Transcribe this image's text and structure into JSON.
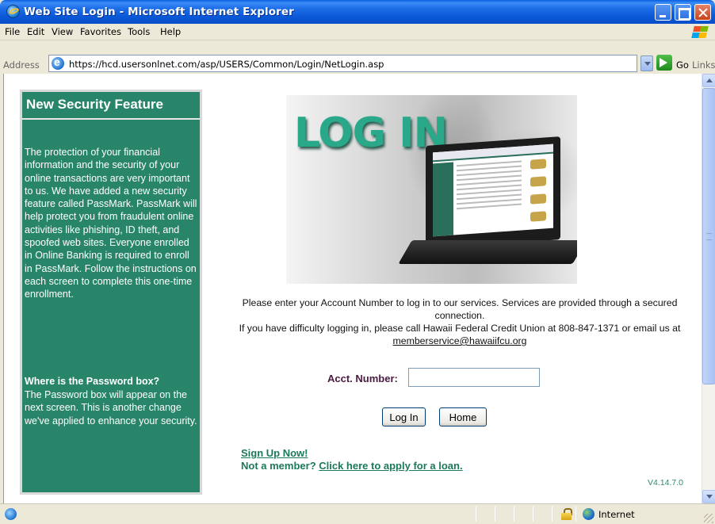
{
  "window": {
    "title": "Web Site Login - Microsoft Internet Explorer"
  },
  "menu": [
    "File",
    "Edit",
    "View",
    "Favorites",
    "Tools",
    "Help"
  ],
  "address": {
    "label": "Address",
    "url": "https://hcd.usersonlnet.com/asp/USERS/Common/Login/NetLogin.asp",
    "go_label": "Go",
    "links_label": "Links"
  },
  "sidebar": {
    "title": "New Security Feature",
    "body": "The protection of your financial information and the security of your online transactions are very important to us. We have added a new security feature called PassMark. PassMark will help protect you from fraudulent online activities like phishing, ID theft, and spoofed web sites. Everyone enrolled in Online Banking is required to enroll in PassMark. Follow the instructions on each screen to complete this one-time enrollment.",
    "subheading": "Where is the Password box?",
    "body2": "The Password box will appear on the next screen. This is another change we've applied to enhance your security."
  },
  "hero": {
    "title": "LOG IN"
  },
  "intro": {
    "line1": "Please enter your Account Number to log in to our services. Services are provided through a secured connection.",
    "line2": "If you have difficulty logging in, please call  Hawaii Federal Credit Union at  808-847-1371 or email us at ",
    "email": "memberservice@hawaiifcu.org"
  },
  "form": {
    "acct_label": "Acct. Number:",
    "acct_value": "",
    "login_label": "Log In",
    "home_label": "Home"
  },
  "footer_links": {
    "signup": "Sign Up Now!",
    "notmember_prefix": "Not a member? ",
    "loan_link": "Click here to apply for a loan.",
    "version": "V4.14.7.0"
  },
  "status": {
    "zone": "Internet"
  },
  "colors": {
    "panel_green": "#288569",
    "link_green": "#1b7a59",
    "label_maroon": "#4a1a40"
  }
}
